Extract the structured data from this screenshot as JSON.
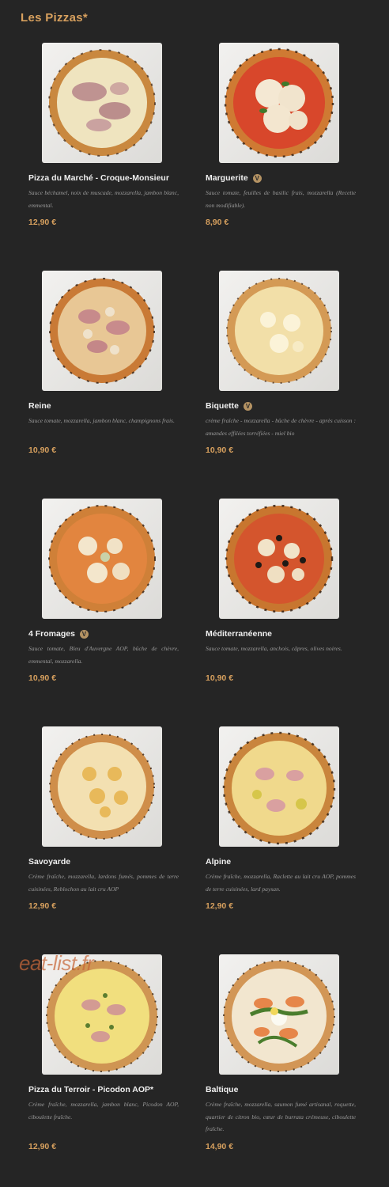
{
  "section_title": "Les Pizzas*",
  "watermark": "eat-list.fr",
  "colors": {
    "background": "#252525",
    "accent": "#d7a05e",
    "name": "#f0f0f0",
    "description": "#9a9a9a"
  },
  "pizzas": [
    {
      "name": "Pizza du Marché - Croque-Monsieur",
      "veg": false,
      "description": "Sauce béchamel, noix de muscade, mozzarella, jambon blanc, emmental.",
      "price": "12,90 €",
      "image_icon": "pizza-image"
    },
    {
      "name": "Marguerite",
      "veg": true,
      "badge_label": "V",
      "description": "Sauce tomate, feuilles de basilic frais, mozzarella (Recette non modifiable).",
      "price": "8,90 €",
      "image_icon": "pizza-image"
    },
    {
      "name": "Reine",
      "veg": false,
      "description": "Sauce tomate, mozzarella, jambon blanc, champignons frais.",
      "price": "10,90 €",
      "image_icon": "pizza-image"
    },
    {
      "name": "Biquette",
      "veg": true,
      "badge_label": "V",
      "description": "crème fraîche - mozzarella - bûche de chèvre - après cuisson : amandes effilées torréfiées - miel bio",
      "price": "10,90 €",
      "image_icon": "pizza-image"
    },
    {
      "name": "4 Fromages",
      "veg": true,
      "badge_label": "V",
      "description": "Sauce tomate, Bleu d'Auvergne AOP, bûche de chèvre, emmental, mozzarella.",
      "price": "10,90 €",
      "image_icon": "pizza-image"
    },
    {
      "name": "Méditerranéenne",
      "veg": false,
      "description": "Sauce tomate, mozzarella, anchois, câpres, olives noires.",
      "price": "10,90 €",
      "image_icon": "pizza-image"
    },
    {
      "name": "Savoyarde",
      "veg": false,
      "description": "Crème fraîche, mozzarella, lardons fumés, pommes de terre cuisinées, Reblochon au lait cru AOP",
      "price": "12,90 €",
      "image_icon": "pizza-image"
    },
    {
      "name": "Alpine",
      "veg": false,
      "description": "Crème fraîche, mozzarella, Raclette au lait cru AOP, pommes de terre cuisinées, lard paysan.",
      "price": "12,90 €",
      "image_icon": "pizza-image"
    },
    {
      "name": "Pizza du Terroir - Picodon AOP*",
      "veg": false,
      "description": "Crème fraîche, mozzarella, jambon blanc, Picodon AOP, ciboulette fraîche.",
      "price": "12,90 €",
      "image_icon": "pizza-image"
    },
    {
      "name": "Baltique",
      "veg": false,
      "description": "Crème fraîche, mozzarella, saumon fumé artisanal, roquette, quartier de citron bio, cœur de burrata crémeuse, ciboulette fraîche.",
      "price": "14,90 €",
      "image_icon": "pizza-image"
    }
  ]
}
